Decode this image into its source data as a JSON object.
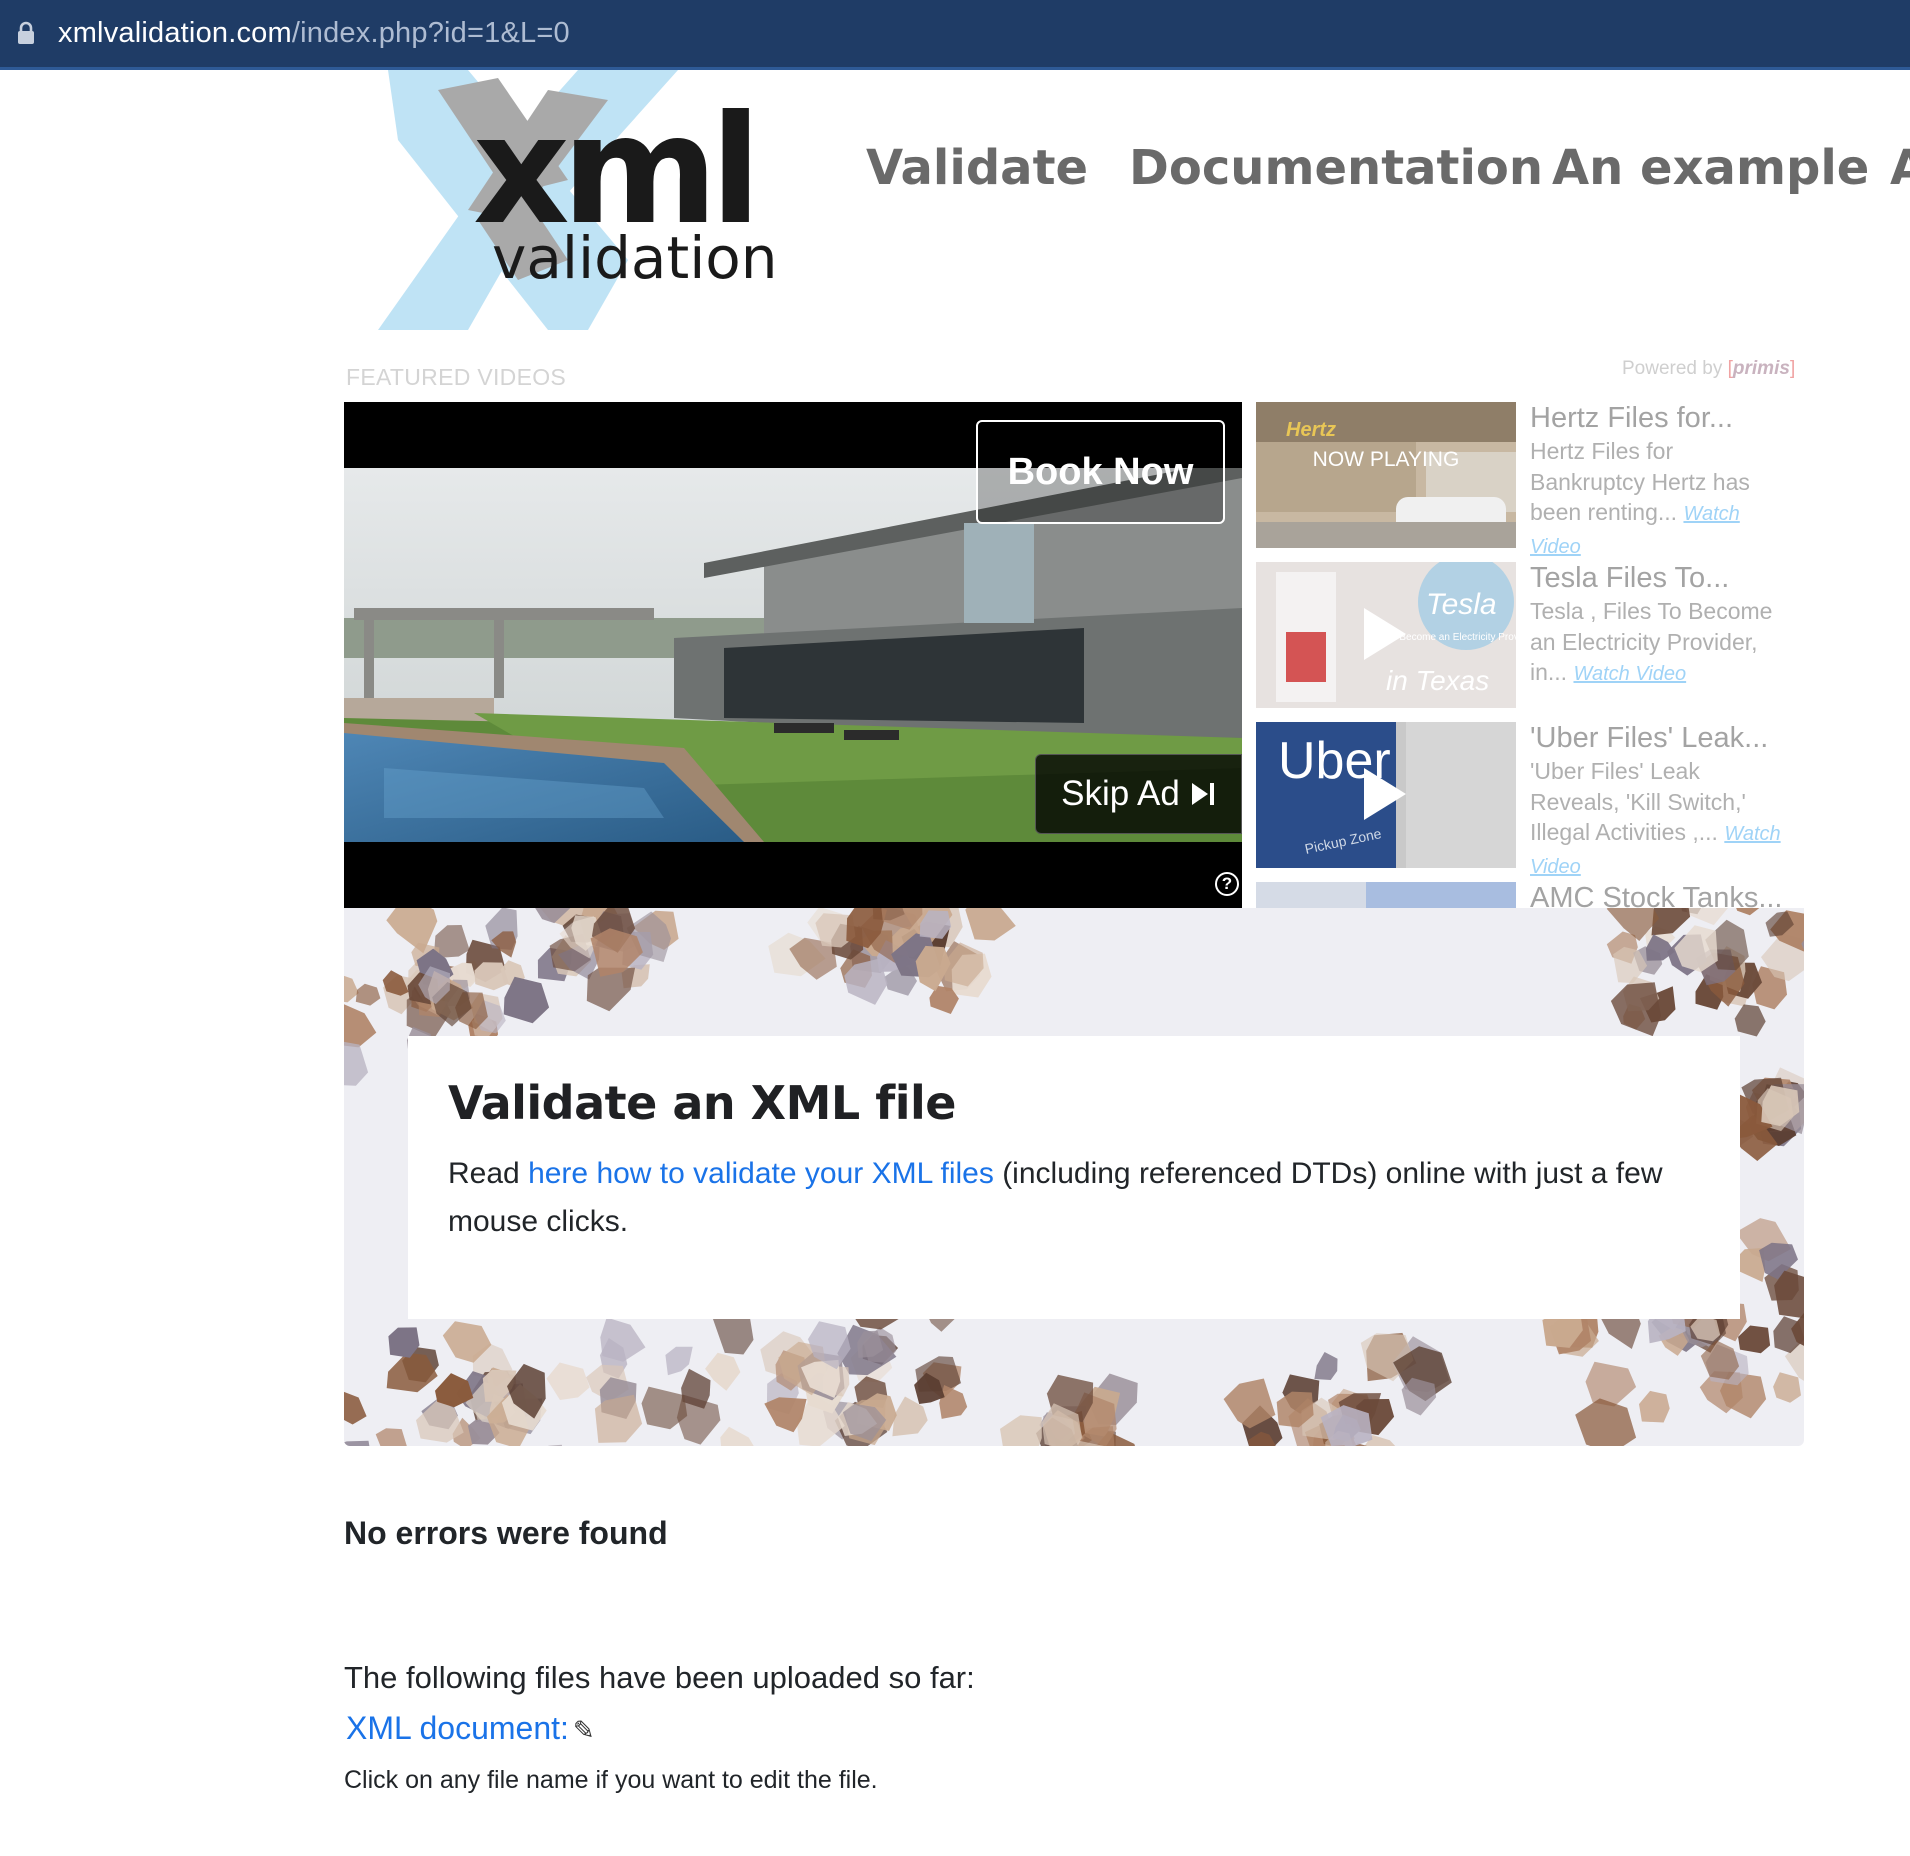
{
  "browser": {
    "url_host": "xmlvalidation.com",
    "url_path": "/index.php?id=1&L=0"
  },
  "logo": {
    "word": "xml",
    "sub": "validation"
  },
  "nav": {
    "items": [
      "Validate",
      "Documentation",
      "An example",
      "A"
    ]
  },
  "videos": {
    "label": "FEATURED VIDEOS",
    "powered_by": "Powered by",
    "powered_brand": "primis",
    "book_now": "Book Now",
    "skip_ad": "Skip Ad",
    "help": "?",
    "now_playing": "NOW PLAYING",
    "playlist": [
      {
        "title": "Hertz Files for...",
        "desc": "Hertz Files for Bankruptcy Hertz has been renting...",
        "watch": "Watch Video",
        "thumb_text": "Hertz"
      },
      {
        "title": "Tesla Files To...",
        "desc": "Tesla , Files To Become an Electricity Provider, in...",
        "watch": "Watch Video",
        "thumb_text": "Tesla",
        "thumb_sub": "To Become an Electricity Provider",
        "thumb_text2": "in Texas"
      },
      {
        "title": "'Uber Files' Leak...",
        "desc": "'Uber Files' Leak Reveals, 'Kill Switch,' Illegal Activities ,...",
        "watch": "Watch Video",
        "thumb_text": "Uber",
        "thumb_sub": "Pickup Zone"
      },
      {
        "title": "AMC Stock Tanks...",
        "desc": "",
        "watch": ""
      }
    ]
  },
  "jumbotron": {
    "title": "Validate an XML file",
    "text_before": "Read ",
    "link": "here how to validate your XML files",
    "text_after": " (including referenced DTDs) online with just a few mouse clicks."
  },
  "result": {
    "status": "No errors were found",
    "uploaded_intro": "The following files have been uploaded so far:",
    "file_link": "XML document:",
    "pencil": "✎",
    "hint": "Click on any file name if you want to edit the file."
  },
  "colors": {
    "urlbar": "#1f3c66",
    "link": "#1a73e8",
    "nav": "#6a6a6a"
  }
}
